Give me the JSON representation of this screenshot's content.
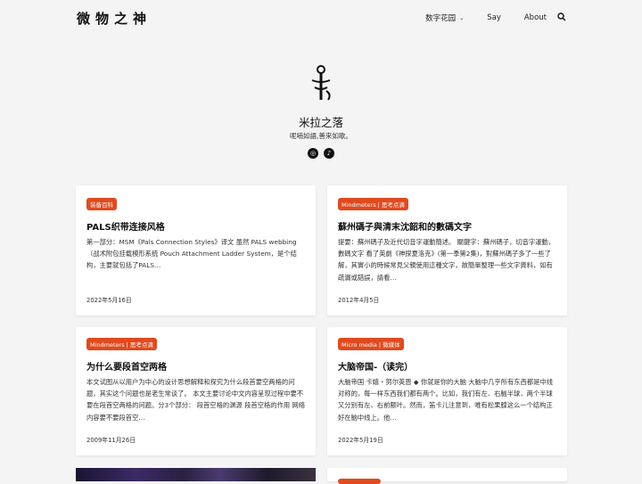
{
  "header": {
    "site_title": "微物之神",
    "nav": [
      {
        "label": "数字花园",
        "has_dropdown": true
      },
      {
        "label": "Say"
      },
      {
        "label": "About"
      }
    ],
    "search_icon": "search-icon"
  },
  "hero": {
    "name": "米拉之落",
    "subtitle": "呢喃如語,善來如歌。",
    "social": [
      {
        "icon": "instagram-icon",
        "glyph": "◎"
      },
      {
        "icon": "tiktok-icon",
        "glyph": "♪"
      }
    ]
  },
  "posts": [
    {
      "tag": "装备百科",
      "title": "PALS织带连接风格",
      "excerpt": "第一部分：MSM《Pals Connection Styles》译文 虽然 PALS webbing （战术附包挂载模形系统 Pouch Attachment Ladder System，是个结构，主要就包括了PALS…",
      "date": "2022年5月16日"
    },
    {
      "tag": "Mindmeters | 思考点滴",
      "title": "蘇州碼子與清末沈韶和的數碼文字",
      "excerpt": "提要：蘇州碼子及近代切音字運動簡述。 關鍵字：蘇州碼子，切音字運動，數碼文字 看了英劇《神探夏洛克》(第一季第2集)，對蘇州碼子多了一些了解，其實小的時候常見父親使用這種文字，故簡單整理一些文字資料，如有疏漏或錯誤，請看…",
      "date": "2012年4月5日"
    },
    {
      "tag": "Mindmeters | 思考点滴",
      "title": "为什么要段首空两格",
      "excerpt": "本文试图从以用户为中心的设计思想解释和探究为什么段首要空两格的问题，其实这个问题也是老生常谈了。 本文主要讨论中文内容呈现过程中要不要在段首空两格的问题。分3个部分： 段首空格的渊源 段首空格的作用 网络内容要不要段首空…",
      "date": "2009年11月26日"
    },
    {
      "tag": "Micro media | 微媒体",
      "title": "大脑帝国-（读完）",
      "excerpt": "大脑帝国 卡嬉・努尔英恩 ◆ 你就是你的大脑 大脑中几乎所有东西都是中线对称的，每一样东西我们都有两个。比如，我们有左、右脑半球，两个半球又分别有左、右前额叶。然而，笛卡儿注意到，唯有松果腺这么一个结构正好在脑中线上。他…",
      "date": "2022年5月19日"
    }
  ],
  "colors": {
    "accent": "#e04a1f",
    "background": "#f4f4f4"
  }
}
